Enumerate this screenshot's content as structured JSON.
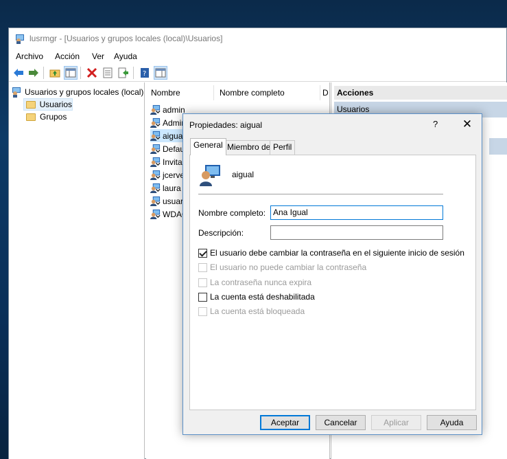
{
  "window": {
    "title": "lusrmgr - [Usuarios y grupos locales (local)\\Usuarios]"
  },
  "menu": [
    "Archivo",
    "Acción",
    "Ver",
    "Ayuda"
  ],
  "tree": {
    "root": "Usuarios y grupos locales (local)",
    "items": [
      "Usuarios",
      "Grupos"
    ]
  },
  "list": {
    "columns": [
      "Nombre",
      "Nombre completo",
      "D"
    ],
    "users": [
      "admin",
      "Admir",
      "aigual",
      "Defau",
      "Invitad",
      "jcerve",
      "laura",
      "usuari",
      "WDAG"
    ]
  },
  "actions": {
    "header": "Acciones",
    "section": "Usuarios"
  },
  "dialog": {
    "title": "Propiedades: aigual",
    "help": "?",
    "close": "✕",
    "tabs": [
      "General",
      "Miembro de",
      "Perfil"
    ],
    "username": "aigual",
    "full_name_label": "Nombre completo:",
    "full_name_value": "Ana Igual",
    "description_label": "Descripción:",
    "description_value": "",
    "checkboxes": [
      {
        "label": "El usuario debe cambiar la contraseña en el siguiente inicio de sesión",
        "checked": true,
        "enabled": true
      },
      {
        "label": "El usuario no puede cambiar la contraseña",
        "checked": false,
        "enabled": false
      },
      {
        "label": "La contraseña nunca expira",
        "checked": false,
        "enabled": false
      },
      {
        "label": "La cuenta está deshabilitada",
        "checked": false,
        "enabled": true
      },
      {
        "label": "La cuenta está bloqueada",
        "checked": false,
        "enabled": false
      }
    ],
    "buttons": {
      "ok": "Aceptar",
      "cancel": "Cancelar",
      "apply": "Aplicar",
      "help": "Ayuda"
    }
  }
}
